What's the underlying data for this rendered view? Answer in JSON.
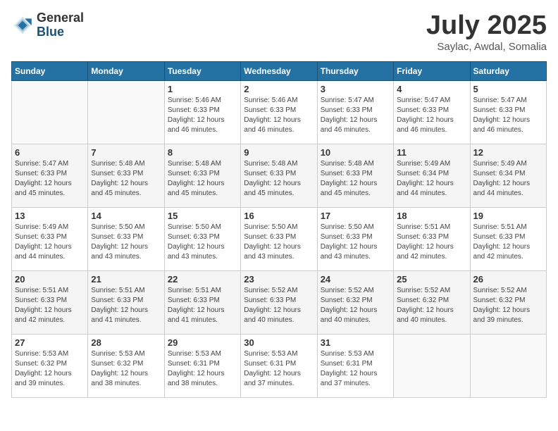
{
  "logo": {
    "general": "General",
    "blue": "Blue"
  },
  "title": "July 2025",
  "location": "Saylac, Awdal, Somalia",
  "days_of_week": [
    "Sunday",
    "Monday",
    "Tuesday",
    "Wednesday",
    "Thursday",
    "Friday",
    "Saturday"
  ],
  "weeks": [
    [
      {
        "day": "",
        "details": ""
      },
      {
        "day": "",
        "details": ""
      },
      {
        "day": "1",
        "details": "Sunrise: 5:46 AM\nSunset: 6:33 PM\nDaylight: 12 hours and 46 minutes."
      },
      {
        "day": "2",
        "details": "Sunrise: 5:46 AM\nSunset: 6:33 PM\nDaylight: 12 hours and 46 minutes."
      },
      {
        "day": "3",
        "details": "Sunrise: 5:47 AM\nSunset: 6:33 PM\nDaylight: 12 hours and 46 minutes."
      },
      {
        "day": "4",
        "details": "Sunrise: 5:47 AM\nSunset: 6:33 PM\nDaylight: 12 hours and 46 minutes."
      },
      {
        "day": "5",
        "details": "Sunrise: 5:47 AM\nSunset: 6:33 PM\nDaylight: 12 hours and 46 minutes."
      }
    ],
    [
      {
        "day": "6",
        "details": "Sunrise: 5:47 AM\nSunset: 6:33 PM\nDaylight: 12 hours and 45 minutes."
      },
      {
        "day": "7",
        "details": "Sunrise: 5:48 AM\nSunset: 6:33 PM\nDaylight: 12 hours and 45 minutes."
      },
      {
        "day": "8",
        "details": "Sunrise: 5:48 AM\nSunset: 6:33 PM\nDaylight: 12 hours and 45 minutes."
      },
      {
        "day": "9",
        "details": "Sunrise: 5:48 AM\nSunset: 6:33 PM\nDaylight: 12 hours and 45 minutes."
      },
      {
        "day": "10",
        "details": "Sunrise: 5:48 AM\nSunset: 6:33 PM\nDaylight: 12 hours and 45 minutes."
      },
      {
        "day": "11",
        "details": "Sunrise: 5:49 AM\nSunset: 6:34 PM\nDaylight: 12 hours and 44 minutes."
      },
      {
        "day": "12",
        "details": "Sunrise: 5:49 AM\nSunset: 6:34 PM\nDaylight: 12 hours and 44 minutes."
      }
    ],
    [
      {
        "day": "13",
        "details": "Sunrise: 5:49 AM\nSunset: 6:33 PM\nDaylight: 12 hours and 44 minutes."
      },
      {
        "day": "14",
        "details": "Sunrise: 5:50 AM\nSunset: 6:33 PM\nDaylight: 12 hours and 43 minutes."
      },
      {
        "day": "15",
        "details": "Sunrise: 5:50 AM\nSunset: 6:33 PM\nDaylight: 12 hours and 43 minutes."
      },
      {
        "day": "16",
        "details": "Sunrise: 5:50 AM\nSunset: 6:33 PM\nDaylight: 12 hours and 43 minutes."
      },
      {
        "day": "17",
        "details": "Sunrise: 5:50 AM\nSunset: 6:33 PM\nDaylight: 12 hours and 43 minutes."
      },
      {
        "day": "18",
        "details": "Sunrise: 5:51 AM\nSunset: 6:33 PM\nDaylight: 12 hours and 42 minutes."
      },
      {
        "day": "19",
        "details": "Sunrise: 5:51 AM\nSunset: 6:33 PM\nDaylight: 12 hours and 42 minutes."
      }
    ],
    [
      {
        "day": "20",
        "details": "Sunrise: 5:51 AM\nSunset: 6:33 PM\nDaylight: 12 hours and 42 minutes."
      },
      {
        "day": "21",
        "details": "Sunrise: 5:51 AM\nSunset: 6:33 PM\nDaylight: 12 hours and 41 minutes."
      },
      {
        "day": "22",
        "details": "Sunrise: 5:51 AM\nSunset: 6:33 PM\nDaylight: 12 hours and 41 minutes."
      },
      {
        "day": "23",
        "details": "Sunrise: 5:52 AM\nSunset: 6:33 PM\nDaylight: 12 hours and 40 minutes."
      },
      {
        "day": "24",
        "details": "Sunrise: 5:52 AM\nSunset: 6:32 PM\nDaylight: 12 hours and 40 minutes."
      },
      {
        "day": "25",
        "details": "Sunrise: 5:52 AM\nSunset: 6:32 PM\nDaylight: 12 hours and 40 minutes."
      },
      {
        "day": "26",
        "details": "Sunrise: 5:52 AM\nSunset: 6:32 PM\nDaylight: 12 hours and 39 minutes."
      }
    ],
    [
      {
        "day": "27",
        "details": "Sunrise: 5:53 AM\nSunset: 6:32 PM\nDaylight: 12 hours and 39 minutes."
      },
      {
        "day": "28",
        "details": "Sunrise: 5:53 AM\nSunset: 6:32 PM\nDaylight: 12 hours and 38 minutes."
      },
      {
        "day": "29",
        "details": "Sunrise: 5:53 AM\nSunset: 6:31 PM\nDaylight: 12 hours and 38 minutes."
      },
      {
        "day": "30",
        "details": "Sunrise: 5:53 AM\nSunset: 6:31 PM\nDaylight: 12 hours and 37 minutes."
      },
      {
        "day": "31",
        "details": "Sunrise: 5:53 AM\nSunset: 6:31 PM\nDaylight: 12 hours and 37 minutes."
      },
      {
        "day": "",
        "details": ""
      },
      {
        "day": "",
        "details": ""
      }
    ]
  ]
}
